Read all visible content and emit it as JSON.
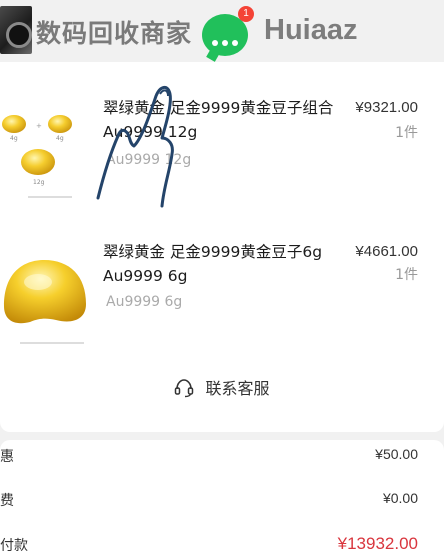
{
  "watermark": {
    "title": "数码回收商家",
    "badge": "1",
    "name": "Huiaaz"
  },
  "items": [
    {
      "name": "翠绿黄金 足金9999黄金豆子组合 Au9999 12g",
      "spec": "Au9999 12g",
      "price": "¥9321.00",
      "qty": "1件",
      "thumb_labels": [
        "4g",
        "4g",
        "12g"
      ]
    },
    {
      "name": "翠绿黄金 足金9999黄金豆子6g Au9999 6g",
      "spec": "Au9999 6g",
      "price": "¥4661.00",
      "qty": "1件"
    }
  ],
  "contact": {
    "label": "联系客服",
    "icon": "headset-icon"
  },
  "summary": {
    "rows": [
      {
        "label": "惠",
        "value": "¥50.00"
      },
      {
        "label": "费",
        "value": "¥0.00"
      },
      {
        "label": "付款",
        "value": "¥13932.00"
      }
    ]
  },
  "colors": {
    "total": "#d9363e",
    "wechat": "#21c05b",
    "gold": "#f2c230"
  }
}
